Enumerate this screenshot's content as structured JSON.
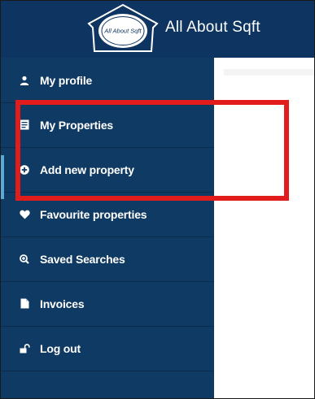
{
  "header": {
    "brand_text": "All About Sqft",
    "logo": {
      "center_text": "All About Sqft",
      "icon": "house-outline-logo"
    },
    "background": "#0e3561"
  },
  "sidebar": {
    "background": "#0f3a63",
    "items": [
      {
        "label": "My profile",
        "icon": "user-icon"
      },
      {
        "label": "My Properties",
        "icon": "document-icon"
      },
      {
        "label": "Add new property",
        "icon": "plus-circle-icon"
      },
      {
        "label": "Favourite properties",
        "icon": "heart-icon"
      },
      {
        "label": "Saved Searches",
        "icon": "search-plus-icon"
      },
      {
        "label": "Invoices",
        "icon": "file-icon"
      },
      {
        "label": "Log out",
        "icon": "unlock-icon"
      }
    ]
  },
  "annotation": {
    "color": "#e21b1b"
  }
}
